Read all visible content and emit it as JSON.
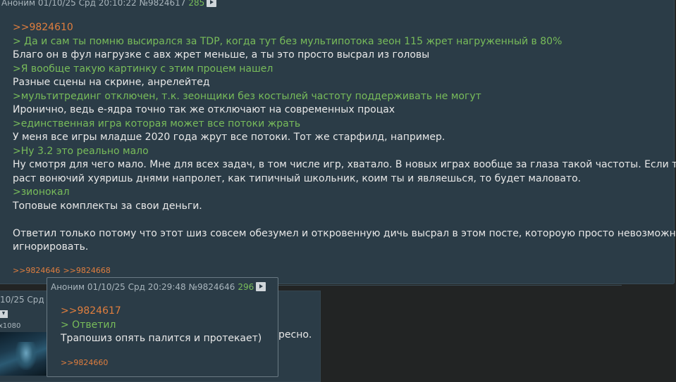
{
  "main_post": {
    "author": "Аноним",
    "datetime": "01/10/25 Срд 20:10:22",
    "number": "№9824617",
    "counter": "285",
    "lines": [
      {
        "type": "reply-link",
        "text": ">>9824610"
      },
      {
        "type": "quote",
        "text": "> Да и сам ты помню высирался за TDP, когда тут без мультипотока зеон 115 жрет нагруженный в 80%"
      },
      {
        "type": "text",
        "text": "Благо он в фул нагрузке с авх жрет меньше, а ты это просто высрал из головы"
      },
      {
        "type": "quote",
        "text": ">Я вообще такую картинку с этим процем нашел"
      },
      {
        "type": "text",
        "text": "Разные сцены на скрине, анрелейтед"
      },
      {
        "type": "quote",
        "text": ">мультитрединг отключен, т.к. зеонщики без костылей частоту поддерживать не могут"
      },
      {
        "type": "text",
        "text": "Иронично, ведь е-ядра точно так же отключают на современных процах"
      },
      {
        "type": "quote",
        "text": ">единственная игра которая может все потоки жрать"
      },
      {
        "type": "text",
        "text": "У меня все игры младше 2020 года жрут все потоки. Тот же старфилд, например."
      },
      {
        "type": "quote",
        "text": ">Ну 3.2 это реально мало"
      },
      {
        "type": "text",
        "text": "Ну смотря для чего мало. Мне для всех задач, в том числе игр, хватало. В новых играх вообще за глаза такой частоты. Если ты в"
      },
      {
        "type": "text",
        "text": "раст вонючий хуяришь днями напролет, как типичный школьник, коим ты и являешься, то будет маловато."
      },
      {
        "type": "quote",
        "text": ">зионокал"
      },
      {
        "type": "text",
        "text": "Топовые комплекты за свои деньги."
      },
      {
        "type": "text",
        "text": ""
      },
      {
        "type": "text",
        "text": "Ответил только потому что этот шиз совсем обезумел и откровенную дичь высрал в этом посте, котороую просто невозможно"
      },
      {
        "type": "text",
        "text": "игнорировать."
      }
    ],
    "replies": [
      ">>9824646",
      ">>9824668"
    ]
  },
  "popup_post": {
    "author": "Аноним",
    "datetime": "01/10/25 Срд 20:29:48",
    "number": "№9824646",
    "counter": "296",
    "lines": [
      {
        "type": "reply-link",
        "text": ">>9824617"
      },
      {
        "type": "quote",
        "text": "> Ответил"
      },
      {
        "type": "text",
        "text": "Трапошиз опять палится и протекает)"
      }
    ],
    "replies": [
      ">>9824660"
    ]
  },
  "under_post": {
    "datetime_fragment": "10/25 Срд",
    "resolution_fragment": "x1080",
    "text_fragment": "ресно."
  },
  "colors": {
    "background": "#222424",
    "post_bg": "#2b3c47",
    "reply_link": "#e07e3e",
    "quote": "#78bc5a",
    "text": "#e8e8e8",
    "meta": "#a9b5bc"
  }
}
